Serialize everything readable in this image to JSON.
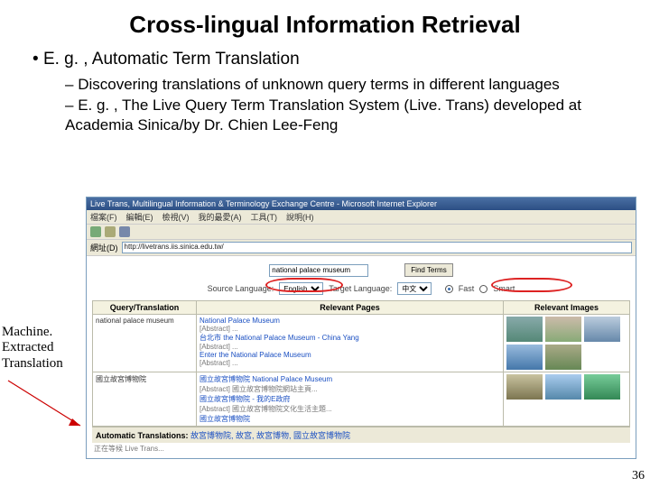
{
  "title": "Cross-lingual Information Retrieval",
  "b1": "E. g. , Automatic Term Translation",
  "b2a": "Discovering translations of unknown query terms in different languages",
  "b2b": "E. g. , The Live Query Term Translation System (Live. Trans) developed at Academia Sinica/by Dr. Chien Lee-Feng",
  "annotation": {
    "l1": "Machine.",
    "l2": "Extracted",
    "l3": "Translation"
  },
  "pagenum": "36",
  "browser": {
    "window_title": "Live Trans, Multilingual Information & Terminology Exchange Centre - Microsoft Internet Explorer",
    "menu": [
      "檔案(F)",
      "編輯(E)",
      "檢視(V)",
      "我的最愛(A)",
      "工具(T)",
      "說明(H)"
    ],
    "addr_label": "網址(D)",
    "addr": "http://livetrans.iis.sinica.edu.tw/",
    "query_value": "national palace museum",
    "find_btn": "Find Terms",
    "src_lang_label": "Source Language:",
    "src_lang": "English",
    "tgt_lang_label": "Target Language:",
    "tgt_lang": "中文",
    "radio1": "Fast",
    "radio2": "Smart",
    "headers": {
      "q": "Query/Translation",
      "p": "Relevant Pages",
      "i": "Relevant Images"
    },
    "row1": {
      "q": "national palace museum",
      "pages": [
        "National Palace Museum",
        "[Abstract] ...",
        "台北市 the National Palace Museum - China Yang",
        "[Abstract] ...",
        "Enter the National Palace Museum",
        "[Abstract] ..."
      ]
    },
    "row2": {
      "q": "國立故宮博物院",
      "pages": [
        "國立故宮博物院 National Palace Museum",
        "[Abstract] 國立故宮博物院網站主頁...",
        "國立故宮博物院 - 我的E政府",
        "[Abstract] 國立故宮博物院文化生活主題...",
        "國立故宮博物院"
      ]
    },
    "auto_label": "Automatic Translations:",
    "auto_items": "故宮博物院, 故宮, 故宮博物, 國立故宮博物院",
    "status": "正在等候 Live Trans..."
  }
}
